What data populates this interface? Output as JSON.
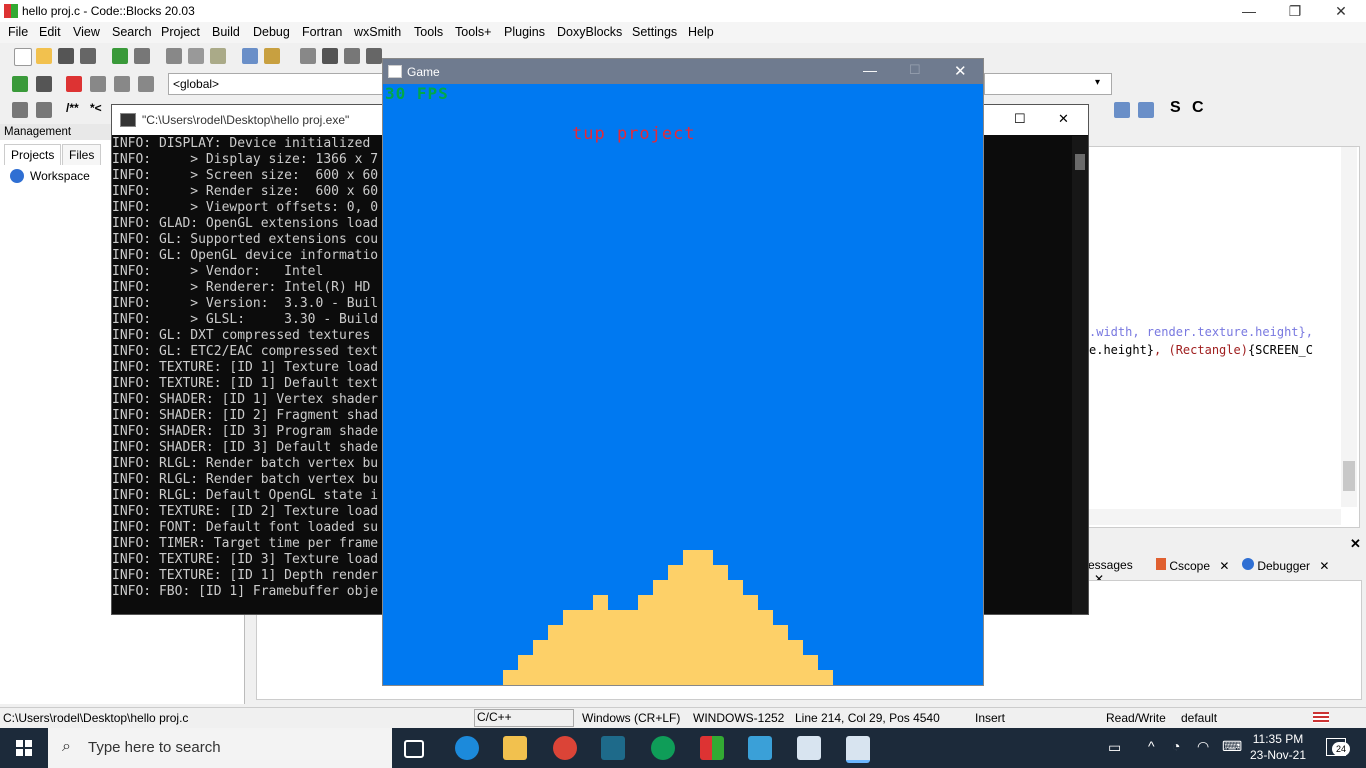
{
  "titlebar": {
    "title": "hello proj.c - Code::Blocks 20.03",
    "minimize": "—",
    "maximize": "❐",
    "close": "✕"
  },
  "menu": [
    "File",
    "Edit",
    "View",
    "Search",
    "Project",
    "Build",
    "Debug",
    "Fortran",
    "wxSmith",
    "Tools",
    "Tools+",
    "Plugins",
    "DoxyBlocks",
    "Settings",
    "Help"
  ],
  "toolbar": {
    "scope": "<global>",
    "comment_a": "/**",
    "comment_b": "*<"
  },
  "management": {
    "title": "Management",
    "tabs": [
      "Projects",
      "Files"
    ],
    "tree_root": "Workspace"
  },
  "editor": {
    "line1": ".width, render.texture.height},",
    "line2_a": "e.height}",
    "line2_b": ", (Rectangle)",
    "line2_c": "{SCREEN_C"
  },
  "logs": {
    "tabs": [
      {
        "label": "essages",
        "close": "✕"
      },
      {
        "label": "Cscope",
        "close": "✕"
      },
      {
        "label": "Debugger",
        "close": "✕"
      }
    ]
  },
  "console": {
    "title": "\"C:\\Users\\rodel\\Desktop\\hello proj.exe\"",
    "lines": [
      "INFO: DISPLAY: Device initialized",
      "INFO:     > Display size: 1366 x 7",
      "INFO:     > Screen size:  600 x 60",
      "INFO:     > Render size:  600 x 60",
      "INFO:     > Viewport offsets: 0, 0",
      "INFO: GLAD: OpenGL extensions load",
      "INFO: GL: Supported extensions cou",
      "INFO: GL: OpenGL device informatio",
      "INFO:     > Vendor:   Intel",
      "INFO:     > Renderer: Intel(R) HD",
      "INFO:     > Version:  3.3.0 - Buil",
      "INFO:     > GLSL:     3.30 - Build",
      "INFO: GL: DXT compressed textures",
      "INFO: GL: ETC2/EAC compressed text",
      "INFO: TEXTURE: [ID 1] Texture load",
      "INFO: TEXTURE: [ID 1] Default text",
      "INFO: SHADER: [ID 1] Vertex shader",
      "INFO: SHADER: [ID 2] Fragment shad",
      "INFO: SHADER: [ID 3] Program shade",
      "INFO: SHADER: [ID 3] Default shade",
      "INFO: RLGL: Render batch vertex bu",
      "INFO: RLGL: Render batch vertex bu",
      "INFO: RLGL: Default OpenGL state i",
      "INFO: TEXTURE: [ID 2] Texture load",
      "INFO: FONT: Default font loaded su",
      "INFO: TIMER: Target time per frame",
      "INFO: TEXTURE: [ID 3] Texture load",
      "INFO: TEXTURE: [ID 1] Depth render",
      "INFO: FBO: [ID 1] Framebuffer obje"
    ]
  },
  "game": {
    "title": "Game",
    "fps": "30 FPS",
    "caption": "tup project",
    "colors": {
      "sky": "#0079f1",
      "sand": "#fdd068",
      "fps": "#00a849",
      "caption": "#e62937"
    }
  },
  "statusbar": {
    "path": "C:\\Users\\rodel\\Desktop\\hello proj.c",
    "language": "C/C++",
    "eol": "Windows (CR+LF)",
    "encoding": "WINDOWS-1252",
    "position": "Line 214, Col 29, Pos 4540",
    "mode": "Insert",
    "access": "Read/Write",
    "profile": "default"
  },
  "taskbar": {
    "search_placeholder": "Type here to search",
    "time": "11:35 PM",
    "date": "23-Nov-21",
    "notifications": "24"
  }
}
